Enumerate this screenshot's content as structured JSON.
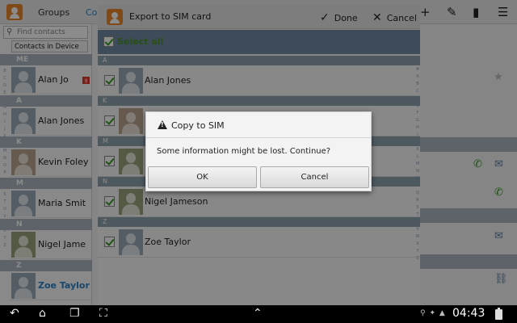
{
  "app": {
    "tabs": [
      {
        "label": "Groups"
      },
      {
        "label": "Co"
      }
    ],
    "search_placeholder": "Find contacts",
    "contacts_source": "Contacts in Device",
    "index_left": "#\nA\nB\nC\nD\nE\nF\nG\nH\nI\nJ\nK\nL\nM\nN\nO\nP\nQ\nR\nS\nT\nU\nV\nW\nX\nY\nZ",
    "index_right": "#\nA\nB\nC\nD\nE\nF\nG\nH\nI\nJ\nK\nL\nM\nN\nO\nP\nQ\nR\nS\nT\nU\nV\nW\nX\nY\nZ",
    "sections": [
      {
        "letter": "ME",
        "name": "Alan Jo"
      },
      {
        "letter": "A",
        "name": "Alan Jones"
      },
      {
        "letter": "K",
        "name": "Kevin Foley"
      },
      {
        "letter": "M",
        "name": "Maria Smit"
      },
      {
        "letter": "N",
        "name": "Nigel Jame"
      },
      {
        "letter": "Z",
        "name": "Zoe Taylor"
      }
    ]
  },
  "export_dialog": {
    "title": "Export to SIM card",
    "done_label": "Done",
    "cancel_label": "Cancel",
    "select_all_label": "Select all",
    "sections": [
      {
        "letter": "A",
        "name": "Alan Jones"
      },
      {
        "letter": "K",
        "name": ""
      },
      {
        "letter": "M",
        "name": ""
      },
      {
        "letter": "N",
        "name": "Nigel Jameson"
      },
      {
        "letter": "Z",
        "name": "Zoe Taylor"
      }
    ]
  },
  "copy_dialog": {
    "title": "Copy to SIM",
    "message": "Some information might be lost. Continue?",
    "ok_label": "OK",
    "cancel_label": "Cancel"
  },
  "system_bar": {
    "time": "04:43"
  },
  "colors": {
    "accent": "#2a82c7",
    "check": "#3a9a25",
    "section_header": "#8ea0ae",
    "brand_icon": "#e7872c"
  }
}
